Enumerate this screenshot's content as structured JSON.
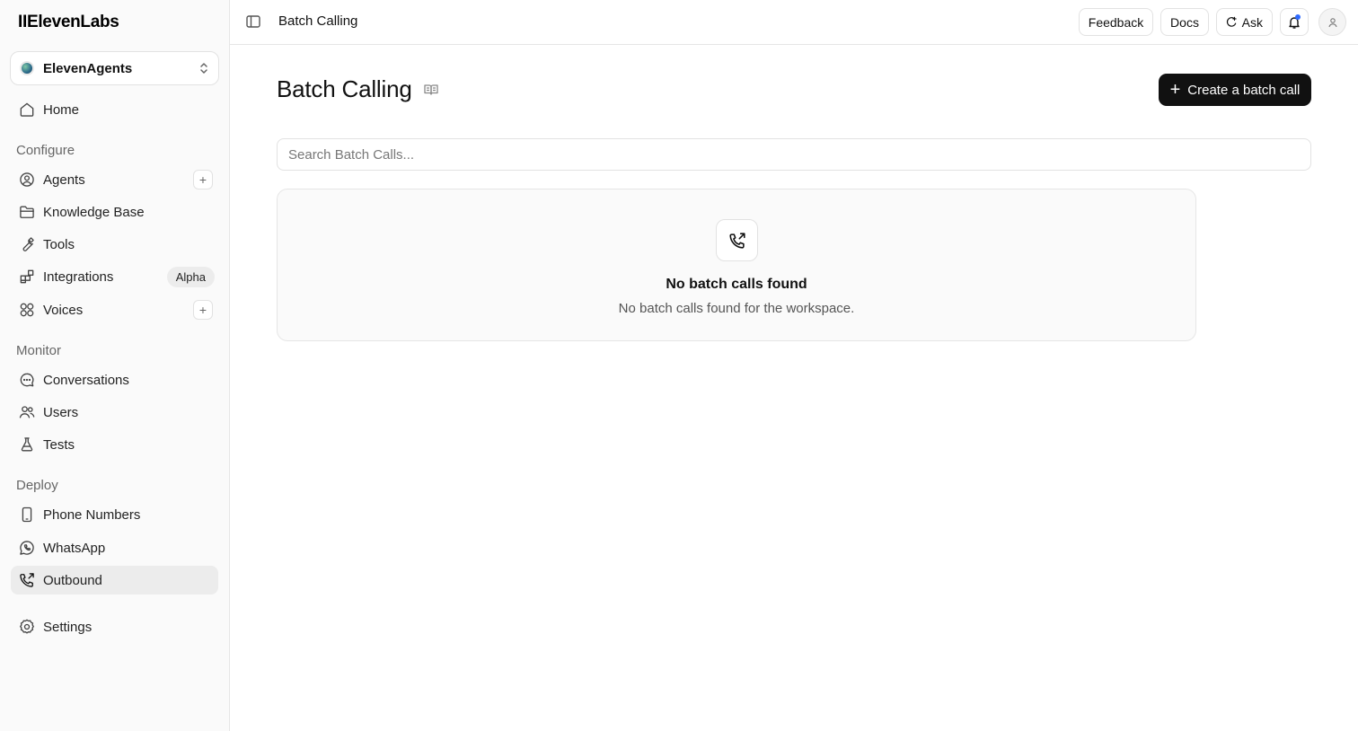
{
  "sidebar": {
    "logo": "IIElevenLabs",
    "workspace": "ElevenAgents",
    "home": "Home",
    "sections": {
      "configure": "Configure",
      "monitor": "Monitor",
      "deploy": "Deploy"
    },
    "configure_items": [
      {
        "label": "Agents",
        "icon": "agent-icon"
      },
      {
        "label": "Knowledge Base",
        "icon": "folder-icon"
      },
      {
        "label": "Tools",
        "icon": "wrench-icon"
      },
      {
        "label": "Integrations",
        "icon": "integrations-icon",
        "badge": "Alpha"
      },
      {
        "label": "Voices",
        "icon": "voices-icon"
      }
    ],
    "monitor_items": [
      {
        "label": "Conversations",
        "icon": "chat-icon"
      },
      {
        "label": "Users",
        "icon": "users-icon"
      },
      {
        "label": "Tests",
        "icon": "flask-icon"
      }
    ],
    "deploy_items": [
      {
        "label": "Phone Numbers",
        "icon": "phone-icon"
      },
      {
        "label": "WhatsApp",
        "icon": "whatsapp-icon"
      },
      {
        "label": "Outbound",
        "icon": "outbound-call-icon",
        "active": true
      }
    ],
    "settings": "Settings"
  },
  "topbar": {
    "breadcrumb": "Batch Calling",
    "feedback": "Feedback",
    "docs": "Docs",
    "ask": "Ask"
  },
  "main": {
    "title": "Batch Calling",
    "create_button": "Create a batch call",
    "search_placeholder": "Search Batch Calls...",
    "empty_title": "No batch calls found",
    "empty_subtitle": "No batch calls found for the workspace."
  },
  "colors": {
    "accent": "#111111",
    "notification_dot": "#2f6bff"
  }
}
